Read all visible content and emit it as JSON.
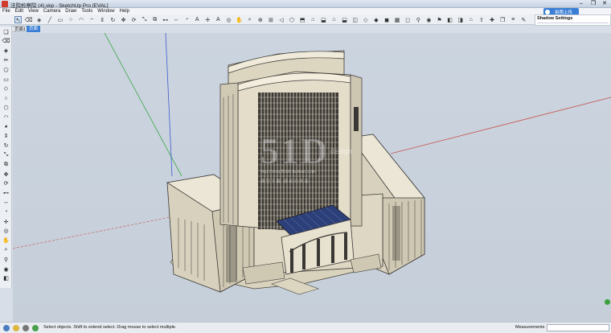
{
  "window": {
    "title": "法院检察院 (4).skp - SketchUp Pro [EVAL]",
    "minimize": "–",
    "maximize": "❐",
    "close": "✕"
  },
  "menu": [
    "File",
    "Edit",
    "View",
    "Camera",
    "Draw",
    "Tools",
    "Window",
    "Help"
  ],
  "cloud_badge": {
    "label": "拍照上传"
  },
  "scene_tabs": [
    {
      "label": "页面1",
      "active": false
    },
    {
      "label": "页面",
      "active": true
    }
  ],
  "shadow_panel": {
    "title": "Shadow Settings"
  },
  "watermark": {
    "main": "51D",
    "sub": "design",
    "url": "http://shop51dd.taobao.com",
    "tag": "模型下载 请访问本店"
  },
  "toolbar_icons": [
    "select-icon",
    "eraser-icon",
    "paint-bucket-icon",
    "line-icon",
    "rectangle-icon",
    "circle-icon",
    "arc-icon",
    "freehand-icon",
    "push-pull-icon",
    "follow-me-icon",
    "move-icon",
    "rotate-icon",
    "scale-icon",
    "offset-icon",
    "tape-measure-icon",
    "dimension-icon",
    "protractor-icon",
    "text-icon",
    "axes-icon",
    "3d-text-icon",
    "orbit-icon",
    "pan-icon",
    "zoom-icon",
    "zoom-window-icon",
    "zoom-extents-icon",
    "previous-icon",
    "iso-view-icon",
    "top-view-icon",
    "front-view-icon",
    "right-view-icon",
    "back-view-icon",
    "left-view-icon",
    "xray-icon",
    "wireframe-icon",
    "hidden-line-icon",
    "shaded-icon",
    "textured-icon",
    "monochrome-icon",
    "walk-icon",
    "look-around-icon",
    "position-camera-icon",
    "section-plane-icon",
    "display-section-icon",
    "warehouse-icon",
    "share-model-icon",
    "extension-icon",
    "component-icon",
    "layers-icon",
    "styles-icon"
  ],
  "left_tools": [
    "make-component-icon",
    "eraser-icon",
    "paint-bucket-icon",
    "pencil-icon",
    "shape-icon",
    "rectangle-icon",
    "rotated-rect-icon",
    "circle-icon",
    "polygon-icon",
    "arc-icon",
    "pie-icon",
    "push-pull-icon",
    "follow-me-icon",
    "scale-icon",
    "offset-icon",
    "move-icon",
    "rotate-icon",
    "tape-measure-icon",
    "dimension-icon",
    "protractor-icon",
    "axes-icon",
    "orbit-icon",
    "pan-icon",
    "zoom-icon",
    "walk-icon",
    "look-around-icon",
    "section-plane-icon"
  ],
  "status": {
    "text": "Select objects. Shift to extend select. Drag mouse to select multiple.",
    "measurements_label": "Measurements",
    "measurements_value": ""
  },
  "colors": {
    "axis_red": "#c8504a",
    "axis_green": "#3fa84a",
    "axis_blue": "#3f5bd0",
    "building_face": "#e9e4d3",
    "building_dark": "#3a3835",
    "glass": "#2c3f78"
  }
}
